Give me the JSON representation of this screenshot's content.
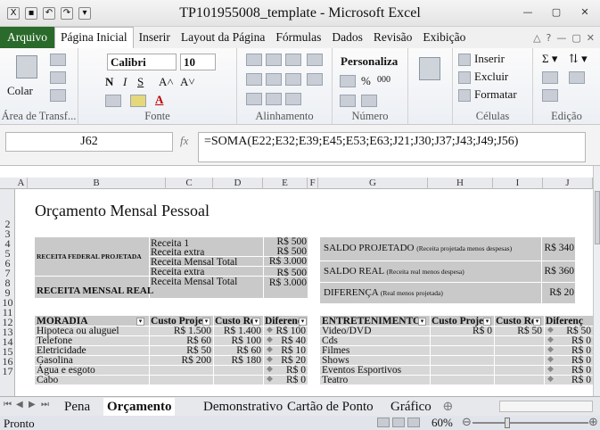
{
  "window": {
    "title": "TP101955008_template - Microsoft Excel"
  },
  "ribbon_tabs": [
    "Arquivo",
    "Página Inicial",
    "Inserir",
    "Layout da Página",
    "Fórmulas",
    "Dados",
    "Revisão",
    "Exibição"
  ],
  "ribbon": {
    "paste_label": "Colar",
    "clipboard_label": "Área de Transf...",
    "font_name": "Calibri",
    "font_size": "10",
    "font_label": "Fonte",
    "align_label": "Alinhamento",
    "number_format": "Personaliza",
    "number_label": "Número",
    "insert_label": "Inserir",
    "delete_label": "Excluir",
    "format_label": "Formatar",
    "cells_label": "Células",
    "edit_label": "Edição"
  },
  "formula_bar": {
    "name_box": "J62",
    "fx": "fx",
    "formula": "=SOMA(E22;E32;E39;E45;E53;E63;J21;J30;J37;J43;J49;J56)"
  },
  "columns": [
    "A",
    "B",
    "C",
    "D",
    "E",
    "F",
    "G",
    "H",
    "I",
    "J"
  ],
  "rows": [
    "2",
    "3",
    "4",
    "5",
    "6",
    "7",
    "8",
    "9",
    "10",
    "11",
    "12",
    "13",
    "14",
    "15",
    "16",
    "17"
  ],
  "sheet": {
    "title": "Orçamento Mensal Pessoal",
    "income": {
      "label_federal": "RECEITA FEDERAL PROJETADA",
      "label_real": "RECEITA MENSAL REAL",
      "rows": [
        {
          "name": "Receita 1",
          "value": "R$ 500"
        },
        {
          "name": "Receita extra",
          "value": "R$ 500"
        },
        {
          "name": "Receita Mensal Total",
          "value": "R$ 3.000"
        },
        {
          "name": "Receita extra",
          "value": "R$ 500"
        },
        {
          "name": "Receita Mensal Total",
          "value": "R$ 3.000"
        }
      ]
    },
    "balance": [
      {
        "label": "SALDO PROJETADO",
        "note": "(Receita projetada menos despesas)",
        "value": "R$ 340"
      },
      {
        "label": "SALDO REAL",
        "note": "(Receita real menos despesa)",
        "value": "R$ 360"
      },
      {
        "label": "DIFERENÇA",
        "note": "(Real menos projetada)",
        "value": "R$ 20"
      }
    ],
    "housing": {
      "headers": [
        "MORADIA",
        "Custo Proje",
        "Custo Re",
        "Diferenç"
      ],
      "rows": [
        {
          "item": "Hipoteca ou aluguel",
          "proj": "R$ 1.500",
          "real": "R$ 1.400",
          "diff": "R$ 100"
        },
        {
          "item": "Telefone",
          "proj": "R$ 60",
          "real": "R$ 100",
          "diff": "R$ 40"
        },
        {
          "item": "Eletricidade",
          "proj": "R$ 50",
          "real": "R$ 60",
          "diff": "R$ 10"
        },
        {
          "item": "Gasolina",
          "proj": "R$ 200",
          "real": "R$ 180",
          "diff": "R$ 20"
        },
        {
          "item": "Água e esgoto",
          "proj": "",
          "real": "",
          "diff": "R$ 0"
        },
        {
          "item": "Cabo",
          "proj": "",
          "real": "",
          "diff": "R$ 0"
        }
      ]
    },
    "entertainment": {
      "headers": [
        "ENTRETENIMENTO",
        "Custo Proje",
        "Custo Re",
        "Diferenç"
      ],
      "rows": [
        {
          "item": "Video/DVD",
          "proj": "R$ 0",
          "real": "R$ 50",
          "diff": "R$ 50"
        },
        {
          "item": "Cds",
          "proj": "",
          "real": "",
          "diff": "R$ 0"
        },
        {
          "item": "Filmes",
          "proj": "",
          "real": "",
          "diff": "R$ 0"
        },
        {
          "item": "Shows",
          "proj": "",
          "real": "",
          "diff": "R$ 0"
        },
        {
          "item": "Eventos Esportivos",
          "proj": "",
          "real": "",
          "diff": "R$ 0"
        },
        {
          "item": "Teatro",
          "proj": "",
          "real": "",
          "diff": "R$ 0"
        }
      ]
    }
  },
  "sheet_tabs": [
    "Pena",
    "Orçamento",
    "Demonstrativo",
    "Cartão de Ponto",
    "Gráfico"
  ],
  "active_sheet": "Orçamento",
  "status": {
    "ready": "Pronto",
    "zoom": "60%"
  }
}
